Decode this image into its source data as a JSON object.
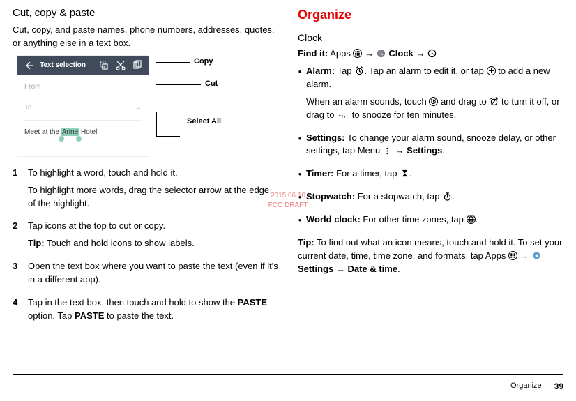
{
  "left": {
    "heading": "Cut, copy & paste",
    "intro": "Cut, copy, and paste names, phone numbers, addresses, quotes, or anything else in a text box.",
    "mock": {
      "topbar_title": "Text selection",
      "from": "From",
      "to": "To",
      "meet_pre": "Meet at the ",
      "meet_hl": "Anne",
      "meet_post": " Hotel"
    },
    "callouts": {
      "copy": "Copy",
      "cut": "Cut",
      "select_all": "Select All"
    },
    "steps": {
      "1a": "To highlight a word, touch and hold it.",
      "1b": "To highlight more words, drag the selector arrow at the edge of the highlight.",
      "2a": "Tap icons at the top to cut or copy.",
      "2tip_label": "Tip:",
      "2tip": " Touch and hold icons to show labels.",
      "3": "Open the text box where you want to paste the text (even if it's in a different app).",
      "4a": "Tap in the text box, then touch and hold to show the ",
      "4paste1": "PASTE",
      "4b": " option. Tap ",
      "4paste2": "PASTE",
      "4c": " to paste the text."
    }
  },
  "right": {
    "heading": "Organize",
    "sub": "Clock",
    "findit_label": "Find it:",
    "findit_a": " Apps ",
    "findit_b": " → ",
    "findit_clock": "Clock",
    "findit_c": " → ",
    "alarm": {
      "label": "Alarm:",
      "a": " Tap ",
      "b": ". Tap an alarm to edit it, or tap ",
      "c": " to add a new alarm.",
      "d": "When an alarm sounds, touch ",
      "e": " and drag to ",
      "f": " to turn it off, or drag to ",
      "g": " to snooze for ten minutes."
    },
    "settings": {
      "label": "Settings:",
      "a": " To change your alarm sound, snooze delay, or other settings, tap Menu ",
      "b": " → ",
      "c": "Settings",
      "d": "."
    },
    "timer": {
      "label": "Timer:",
      "a": " For a timer, tap ",
      "b": "."
    },
    "stopwatch": {
      "label": "Stopwatch:",
      "a": " For a stopwatch, tap ",
      "b": "."
    },
    "world": {
      "label": "World clock:",
      "a": " For other time zones, tap ",
      "b": "."
    },
    "tip": {
      "label": "Tip:",
      "a": " To find out what an icon means, touch and hold it. To set your current date, time, time zone, and formats, tap Apps ",
      "b": " → ",
      "c": "Settings",
      "d": " → ",
      "e": "Date & time",
      "f": "."
    }
  },
  "footer": {
    "section": "Organize",
    "page": "39"
  },
  "watermark": {
    "line1": "2015.06.10",
    "line2": "FCC DRAFT"
  }
}
